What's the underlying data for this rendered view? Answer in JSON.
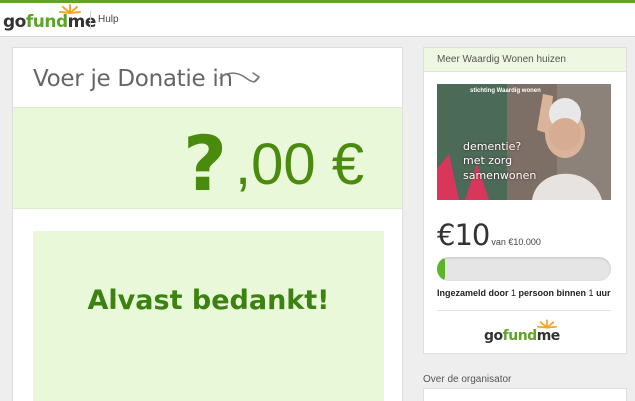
{
  "header": {
    "logo": {
      "part1": "go",
      "part2": "fund",
      "part3": "me"
    },
    "help_label": "Hulp"
  },
  "donation": {
    "title": "Voer je Donatie in",
    "amount_placeholder_symbol": "?",
    "amount_suffix": ",00 €",
    "thanks": "Alvast bedankt!"
  },
  "campaign": {
    "title": "Meer Waardig Wonen huizen",
    "image_org_label": "stichting Waardig wonen",
    "image_text": [
      "dementie?",
      "met zorg",
      "samenwonen"
    ],
    "raised": "€10",
    "goal": "van €10.000",
    "progress_fraction": 0.001,
    "collected": {
      "a": "Ingezameld door ",
      "b": "1",
      "c": " persoon binnen ",
      "d": "1",
      "e": " uur"
    },
    "logo": {
      "part1": "go",
      "part2": "fund",
      "part3": "me"
    }
  },
  "organizer": {
    "label": "Over de organisator"
  },
  "colors": {
    "brand_green": "#5fa42a",
    "amount_green": "#4a8a0c",
    "light_green_bg": "#e9f8d9",
    "sun_orange": "#f5a623"
  }
}
